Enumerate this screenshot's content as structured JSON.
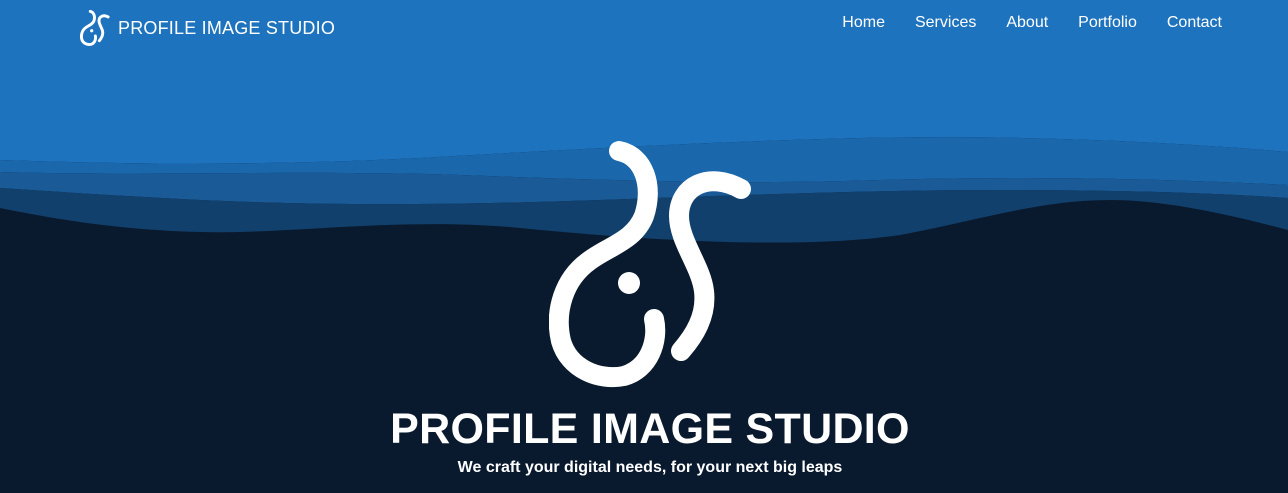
{
  "header": {
    "brand_name": "PROFILE IMAGE STUDIO",
    "logo_icon": "profile-image-studio-logo-icon"
  },
  "nav": {
    "items": [
      {
        "label": "Home"
      },
      {
        "label": "Services"
      },
      {
        "label": "About"
      },
      {
        "label": "Portfolio"
      },
      {
        "label": "Contact"
      }
    ]
  },
  "hero": {
    "title": "PROFILE IMAGE STUDIO",
    "subtitle": "We craft your digital needs, for your next big leaps",
    "logo_icon": "profile-image-studio-logo-icon"
  },
  "colors": {
    "sky_blue": "#1e73be",
    "wave_mid": "#1a5a96",
    "wave_deep": "#12406c",
    "background_dark": "#0a1a2e",
    "text": "#ffffff"
  }
}
